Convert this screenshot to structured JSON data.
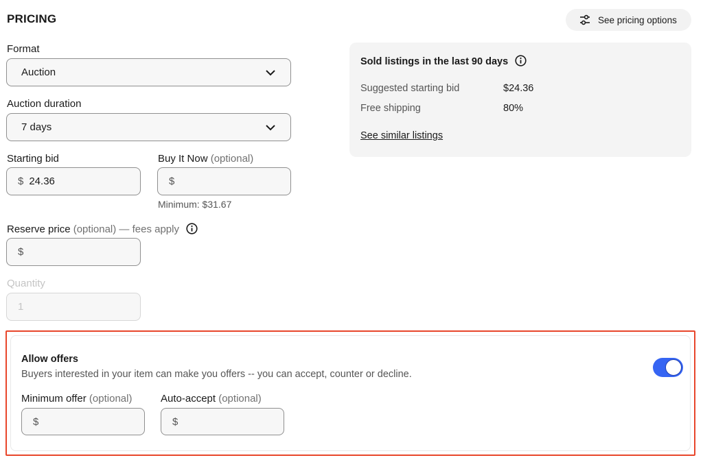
{
  "section": {
    "title": "PRICING"
  },
  "pricing_options_button": {
    "label": "See pricing options",
    "icon": "sliders-icon"
  },
  "format": {
    "label": "Format",
    "value": "Auction"
  },
  "auction_duration": {
    "label": "Auction duration",
    "value": "7 days"
  },
  "starting_bid": {
    "label": "Starting bid",
    "currency": "$",
    "value": "24.36"
  },
  "buy_it_now": {
    "label": "Buy It Now",
    "optional": "(optional)",
    "currency": "$",
    "value": "",
    "hint": "Minimum: $31.67"
  },
  "reserve_price": {
    "label": "Reserve price",
    "optional": "(optional) — fees apply",
    "currency": "$",
    "value": ""
  },
  "quantity": {
    "label": "Quantity",
    "value": "1"
  },
  "sold_listings": {
    "title": "Sold listings in the last 90 days",
    "rows": [
      {
        "label": "Suggested starting bid",
        "value": "$24.36"
      },
      {
        "label": "Free shipping",
        "value": "80%"
      }
    ],
    "link": "See similar listings"
  },
  "allow_offers": {
    "title": "Allow offers",
    "description": "Buyers interested in your item can make you offers -- you can accept, counter or decline.",
    "enabled": true,
    "minimum_offer": {
      "label": "Minimum offer",
      "optional": "(optional)",
      "currency": "$"
    },
    "auto_accept": {
      "label": "Auto-accept",
      "optional": "(optional)",
      "currency": "$"
    }
  },
  "colors": {
    "accent": "#3665f3",
    "highlight_border": "#e8452a",
    "panel_bg": "#f4f4f4"
  }
}
